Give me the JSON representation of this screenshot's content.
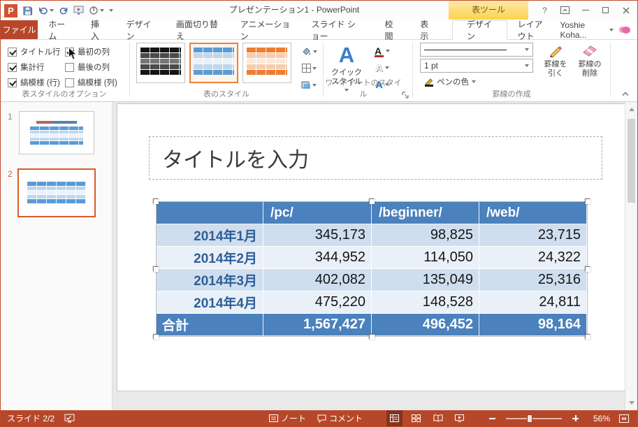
{
  "titlebar": {
    "app_icon_letter": "P",
    "title": "プレゼンテーション1 - PowerPoint",
    "contextual_header": "表ツール",
    "help": "?",
    "user_name": "Yoshie Koha..."
  },
  "tabs": {
    "file": "ファイル",
    "items": [
      "ホーム",
      "挿入",
      "デザイン",
      "画面切り替え",
      "アニメーション",
      "スライド ショー",
      "校閲",
      "表示"
    ],
    "contextual": [
      {
        "label": "デザイン",
        "selected": true
      },
      {
        "label": "レイアウト",
        "selected": false
      }
    ]
  },
  "ribbon": {
    "table_style_options": {
      "label": "表スタイルのオプション",
      "checkboxes": [
        {
          "label": "タイトル行",
          "checked": true
        },
        {
          "label": "集計行",
          "checked": true
        },
        {
          "label": "縞模様 (行)",
          "checked": true
        },
        {
          "label": "最初の列",
          "checked": true
        },
        {
          "label": "最後の列",
          "checked": false
        },
        {
          "label": "縞模様 (列)",
          "checked": false
        }
      ]
    },
    "table_styles": {
      "label": "表のスタイル"
    },
    "wordart": {
      "label": "ワードアートのスタイル",
      "quick_style": "クイック スタイル",
      "letter": "A"
    },
    "draw_borders": {
      "label": "罫線の作成",
      "pen_weight": "1 pt",
      "pen_color": "ペンの色",
      "draw_table": "罫線を引く",
      "eraser": "罫線の削除"
    }
  },
  "slide_panel": {
    "slides": [
      {
        "number": "1"
      },
      {
        "number": "2"
      }
    ]
  },
  "slide": {
    "title_placeholder": "タイトルを入力",
    "table": {
      "header": [
        "",
        "/pc/",
        "/beginner/",
        "/web/"
      ],
      "rows": [
        [
          "2014年1月",
          "345,173",
          "98,825",
          "23,715"
        ],
        [
          "2014年2月",
          "344,952",
          "114,050",
          "24,322"
        ],
        [
          "2014年3月",
          "402,082",
          "135,049",
          "25,316"
        ],
        [
          "2014年4月",
          "475,220",
          "148,528",
          "24,811"
        ]
      ],
      "total": [
        "合計",
        "1,567,427",
        "496,452",
        "98,164"
      ]
    }
  },
  "statusbar": {
    "slide_indicator": "スライド 2/2",
    "notes": "ノート",
    "comments": "コメント",
    "zoom_level": "56%"
  },
  "colors": {
    "app_red": "#B7472A",
    "contextual_gold": "#FBD24E",
    "table_header_blue": "#4B81BC",
    "band_light": "#CFDEEF",
    "band_lighter": "#E9F0F8",
    "selection_orange": "#D95B2B"
  }
}
